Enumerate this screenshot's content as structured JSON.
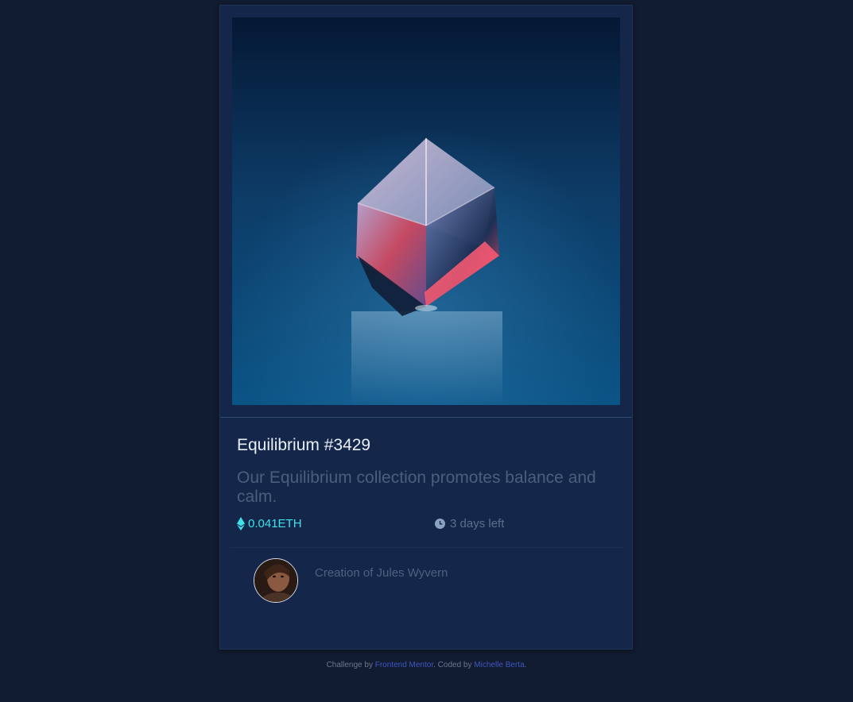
{
  "card": {
    "image_alt": "Equilibrium cube",
    "title": "Equilibrium #3429",
    "description": "Our Equilibrium collection promotes balance and calm.",
    "price": "0.041ETH",
    "time_left": "3 days left",
    "creator": "Creation of Jules Wyvern",
    "icons": {
      "price": "ethereum-icon",
      "time": "clock-icon"
    }
  },
  "attribution": {
    "prefix": "Challenge by ",
    "link1": "Frontend Mentor",
    "middle": ". Coded by ",
    "link2": "Michelle Berta",
    "suffix": "."
  },
  "colors": {
    "page_bg": "#121c30",
    "card_bg": "#14264a",
    "accent_cyan": "#3ee2e9",
    "link_blue": "#3e55c2"
  }
}
